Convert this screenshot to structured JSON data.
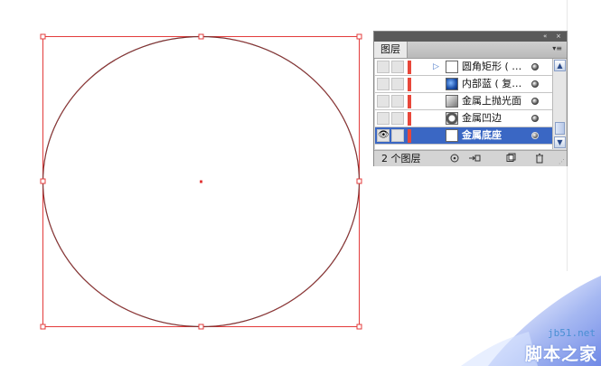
{
  "colors": {
    "selection_red": "#e33b3b",
    "path_dark": "#4a2a2a",
    "panel_bg": "#d4d4d4",
    "selected_row": "#3a67c4",
    "layer_color_bar": "#e8473a",
    "watermark_blue": "#4a8fd4"
  },
  "layers_panel": {
    "collapse_icon": "«",
    "close_icon": "×",
    "tab_label": "图层",
    "menu_icon": "▾≡",
    "layers": [
      {
        "name": "圆角矩形 ( …",
        "thumb": "rect-outline",
        "expandable": true,
        "visible": false,
        "selected": false
      },
      {
        "name": "内部蓝 ( 复…",
        "thumb": "blue-disc",
        "expandable": false,
        "visible": false,
        "selected": false
      },
      {
        "name": "金属上抛光面",
        "thumb": "gray-gradient",
        "expandable": false,
        "visible": false,
        "selected": false
      },
      {
        "name": "金属凹边",
        "thumb": "ring",
        "expandable": false,
        "visible": false,
        "selected": false
      },
      {
        "name": "金属底座",
        "thumb": "white",
        "expandable": false,
        "visible": true,
        "selected": true
      }
    ],
    "footer": {
      "count_label": "2 个图层",
      "locate_icon": "target-icon",
      "sublayer_icon": "new-sublayer-icon",
      "newlayer_icon": "new-layer-icon",
      "delete_icon": "trash-icon"
    },
    "scroll_up": "▲",
    "scroll_down": "▼"
  },
  "watermark": {
    "url": "jb51.net",
    "text": "脚本之家"
  }
}
